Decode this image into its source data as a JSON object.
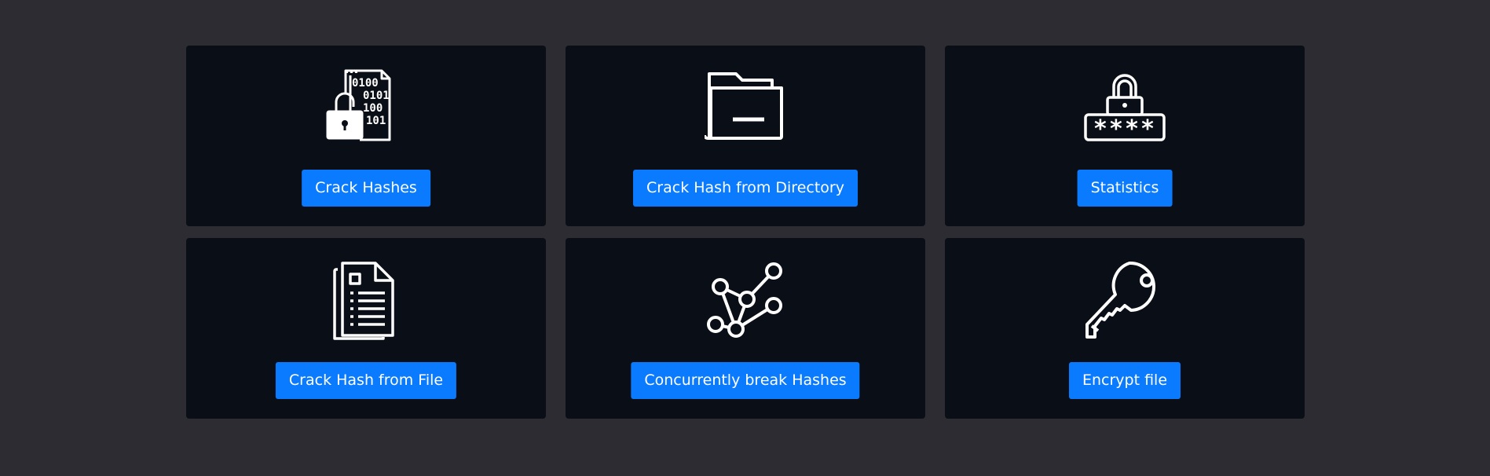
{
  "cards": [
    {
      "icon": "binary-lock-icon",
      "label": "Crack Hashes"
    },
    {
      "icon": "folder-icon",
      "label": "Crack Hash from Directory"
    },
    {
      "icon": "password-lock-icon",
      "label": "Statistics"
    },
    {
      "icon": "document-icon",
      "label": "Crack Hash from File"
    },
    {
      "icon": "nodes-graph-icon",
      "label": "Concurrently break Hashes"
    },
    {
      "icon": "key-icon",
      "label": "Encrypt file"
    }
  ],
  "binary_lines": [
    "0100",
    "0101",
    "100",
    "101"
  ],
  "password_mask": "****",
  "colors": {
    "background": "#2d2c33",
    "card": "#0a0e17",
    "button": "#0a7bff",
    "icon": "#ffffff"
  }
}
